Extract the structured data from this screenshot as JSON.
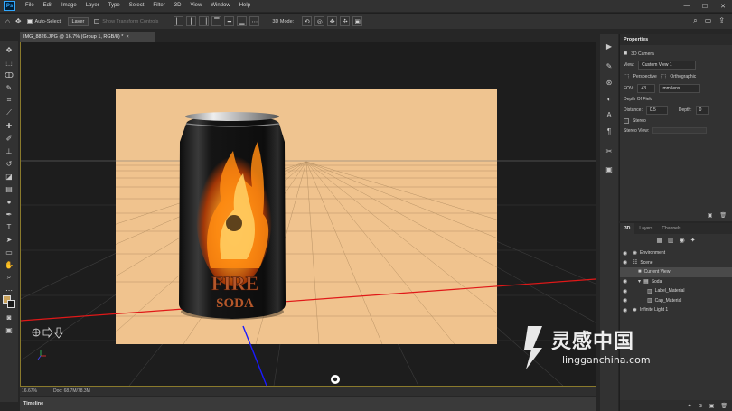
{
  "app": {
    "logo": "Ps"
  },
  "menu": [
    "File",
    "Edit",
    "Image",
    "Layer",
    "Type",
    "Select",
    "Filter",
    "3D",
    "View",
    "Window",
    "Help"
  ],
  "window_controls": [
    "—",
    "☐",
    "✕"
  ],
  "options": {
    "auto_select_label": "Auto-Select:",
    "auto_select_value": "Layer",
    "show_transform": "Show Transform Controls",
    "mode_3d": "3D Mode:"
  },
  "document": {
    "tab_title": "IMG_8826.JPG @ 16.7% (Group 1, RGB/8) *",
    "close": "×"
  },
  "status": {
    "zoom": "16.67%",
    "doc": "Doc: 68.7M/78.3M"
  },
  "timeline": {
    "label": "Timeline"
  },
  "can": {
    "brand": "FIRE",
    "flavor": "SODA"
  },
  "properties": {
    "tab": "Properties",
    "camera_label": "3D Camera",
    "view_label": "View:",
    "view_value": "Custom View 1",
    "perspective": "Perspective",
    "orthographic": "Orthographic",
    "fov_label": "FOV:",
    "fov_value": "43",
    "fov_unit": "mm lens",
    "dof_label": "Depth Of Field",
    "distance_label": "Distance:",
    "distance_value": "0.5",
    "depth_label": "Depth:",
    "depth_value": "0",
    "stereo_label": "Stereo",
    "stereo_view_label": "Stereo View:"
  },
  "panel3d": {
    "tabs": [
      "3D",
      "Layers",
      "Channels"
    ],
    "rows": [
      {
        "label": "Environment",
        "indent": 0,
        "selected": false
      },
      {
        "label": "Scene",
        "indent": 0,
        "selected": false
      },
      {
        "label": "Current View",
        "indent": 1,
        "selected": true
      },
      {
        "label": "Soda",
        "indent": 1,
        "selected": false
      },
      {
        "label": "Label_Material",
        "indent": 2,
        "selected": false
      },
      {
        "label": "Cap_Material",
        "indent": 2,
        "selected": false
      },
      {
        "label": "Infinite Light 1",
        "indent": 0,
        "selected": false
      }
    ]
  },
  "watermark": {
    "text": "灵感中国",
    "url": "lingganchina.com"
  },
  "colors": {
    "accent": "#31a8ff",
    "backdrop": "#f0c38e",
    "selection": "#4a4a4a"
  }
}
